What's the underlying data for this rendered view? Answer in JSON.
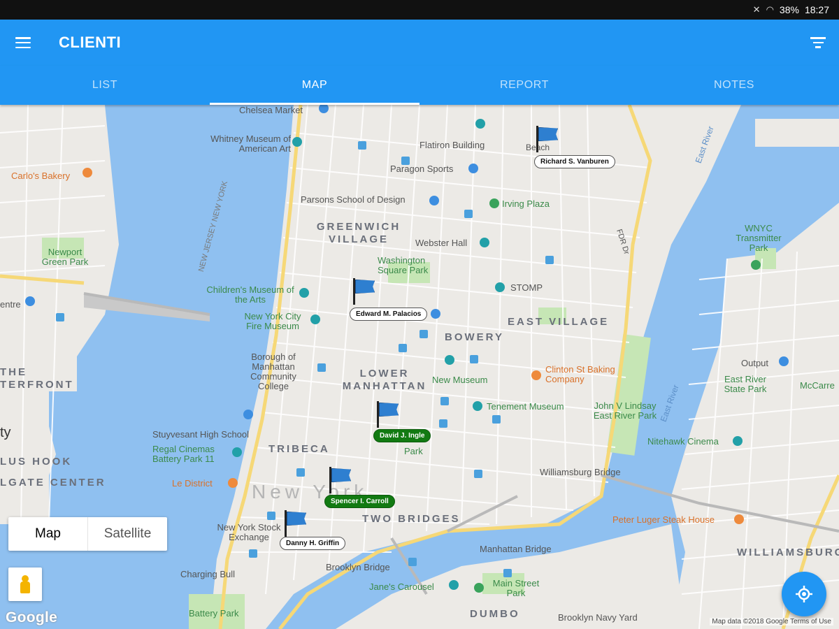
{
  "status": {
    "icons": [
      "mute-icon",
      "wifi-icon"
    ],
    "battery": "38%",
    "time": "18:27"
  },
  "app": {
    "title": "CLIENTI",
    "accent": "#2196f3"
  },
  "tabs": [
    {
      "label": "LIST",
      "active": false
    },
    {
      "label": "MAP",
      "active": true
    },
    {
      "label": "REPORT",
      "active": false
    },
    {
      "label": "NOTES",
      "active": false
    }
  ],
  "map": {
    "places": {
      "chelsea_market": "Chelsea Market",
      "whitney": "Whitney Museum of American Art",
      "flatiron": "Flatiron Building",
      "paragon": "Paragon Sports",
      "parsons": "Parsons School of Design",
      "irving": "Irving Plaza",
      "carlos": "Carlo's Bakery",
      "newport": "Newport Green Park",
      "greenwich": "GREENWICH VILLAGE",
      "webster": "Webster Hall",
      "washington": "Washington Square Park",
      "wnyc": "WNYC Transmitter Park",
      "stomp": "STOMP",
      "childrens": "Children's Museum of the Arts",
      "fire_museum": "New York City Fire Museum",
      "bowery": "BOWERY",
      "east_village": "EAST VILLAGE",
      "bmcc": "Borough of Manhattan Community College",
      "lower_manhattan": "LOWER MANHATTAN",
      "new_museum": "New Museum",
      "clinton": "Clinton St Baking Company",
      "output": "Output",
      "east_river_park": "East River State Park",
      "mccarren": "McCarre",
      "tenement": "Tenement Museum",
      "lindsay": "John V Lindsay East River Park",
      "stuyvesant": "Stuyvesant High School",
      "regal": "Regal Cinemas Battery Park 11",
      "tribeca": "TRIBECA",
      "nitehawk": "Nitehawk Cinema",
      "williamsburg_bridge": "Williamsburg Bridge",
      "le_district": "Le District",
      "new_york": "New York",
      "two_bridges": "TWO BRIDGES",
      "peter_luger": "Peter Luger Steak House",
      "stock_exchange": "New York Stock Exchange",
      "williamsburg": "WILLIAMSBURG",
      "manhattan_bridge": "Manhattan Bridge",
      "charging_bull": "Charging Bull",
      "brooklyn_bridge": "Brooklyn Bridge",
      "janes": "Jane's Carousel",
      "main_street_park": "Main Street Park",
      "battery_park": "Battery Park",
      "dumbo": "DUMBO",
      "navy_yard": "Brooklyn Navy Yard",
      "waterfront": "THE TERFRONT",
      "paulus_hook": "LUS HOOK",
      "colgate": "LGATE CENTER",
      "city": "ty",
      "centre": "entre",
      "east_river": "East River",
      "east_river_2": "East River",
      "fdr": "FDR Dr",
      "nj_ny": "NEW JERSEY NEW YORK",
      "beach": "Beach",
      "park": "Park"
    },
    "clients": [
      {
        "name": "Richard S. Vanburen",
        "status": "default"
      },
      {
        "name": "Edward M. Palacios",
        "status": "default"
      },
      {
        "name": "David J. Ingle",
        "status": "active"
      },
      {
        "name": "Spencer I. Carroll",
        "status": "active"
      },
      {
        "name": "Danny H. Griffin",
        "status": "default"
      }
    ],
    "map_type": {
      "map": "Map",
      "satellite": "Satellite",
      "selected": "Map"
    },
    "logo": "Google",
    "attribution": "Map data ©2018 Google   Terms of Use",
    "colors": {
      "water": "#8fc0f0",
      "land": "#e9eaec",
      "park": "#c6e6b5",
      "highway": "#f6d877",
      "flag": "#2e7fd0",
      "active_tag": "#127a12"
    }
  }
}
